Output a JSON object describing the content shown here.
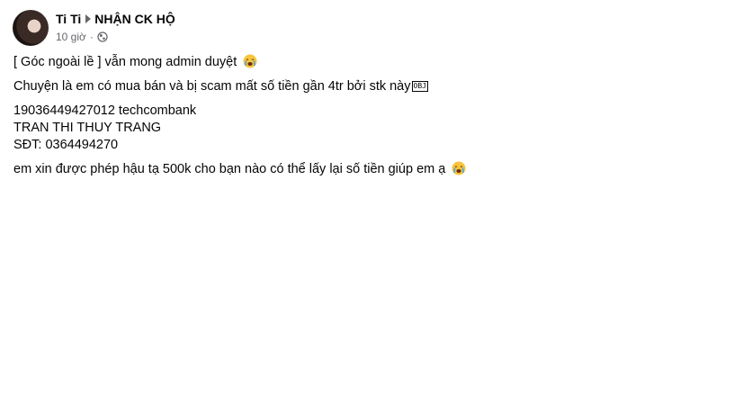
{
  "post": {
    "author": "Ti Ti",
    "group": "NHẬN CK HỘ",
    "time": "10 giờ",
    "separator": "·",
    "privacy_icon": "globe-icon",
    "lines": {
      "l1": "[ Góc ngoài lề ] vẫn mong admin duyệt",
      "l2": "Chuyện là em có mua bán và bị scam mất số tiền gần 4tr bởi stk này",
      "l2_obj": "OBJ",
      "l3": "19036449427012 techcombank",
      "l4": "TRAN THI THUY TRANG",
      "l5": "SĐT: 0364494270",
      "l6": "em xin được phép hậu tạ 500k cho bạn nào có thể lấy lại số tiền giúp em ạ"
    },
    "emoji": "crying-face-emoji"
  }
}
